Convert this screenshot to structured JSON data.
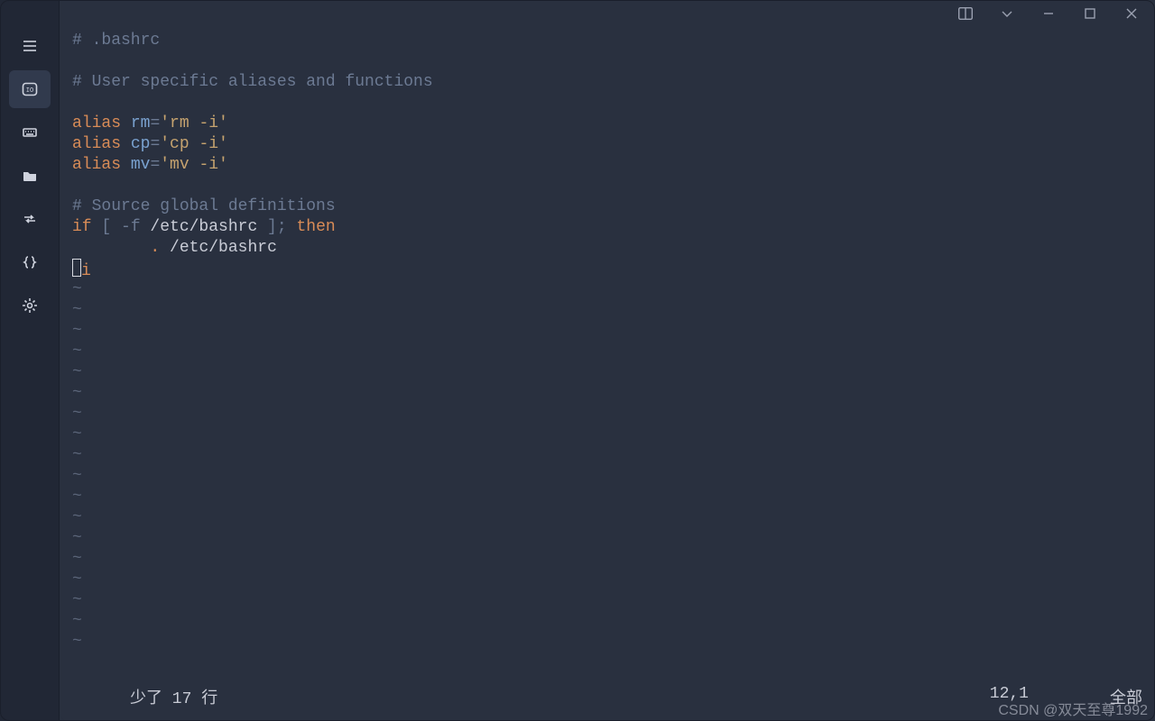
{
  "file": {
    "lines": [
      {
        "type": "comment",
        "raw": "# .bashrc"
      },
      {
        "type": "blank",
        "raw": ""
      },
      {
        "type": "comment",
        "raw": "# User specific aliases and functions"
      },
      {
        "type": "blank",
        "raw": ""
      },
      {
        "type": "alias",
        "kw": "alias",
        "name": "rm",
        "eq": "=",
        "val": "'rm -i'"
      },
      {
        "type": "alias",
        "kw": "alias",
        "name": "cp",
        "eq": "=",
        "val": "'cp -i'"
      },
      {
        "type": "alias",
        "kw": "alias",
        "name": "mv",
        "eq": "=",
        "val": "'mv -i'"
      },
      {
        "type": "blank",
        "raw": ""
      },
      {
        "type": "comment",
        "raw": "# Source global definitions"
      },
      {
        "type": "if",
        "kw": "if",
        "open": " [ ",
        "flag": "-f ",
        "path": "/etc/bashrc",
        "close": " ]; ",
        "then": "then"
      },
      {
        "type": "source",
        "indent": "        ",
        "dot": ".",
        "sep": " ",
        "path": "/etc/bashrc"
      },
      {
        "type": "fi",
        "cursor": true,
        "kw": "fi"
      }
    ],
    "tilde_rows": 18
  },
  "status": {
    "message": "少了 17 行",
    "position": "12,1",
    "whole": "全部"
  },
  "watermark": "CSDN @双天至尊1992",
  "sidebar": {
    "items": [
      {
        "name": "menu-icon"
      },
      {
        "name": "terminal-icon"
      },
      {
        "name": "keyboard-icon"
      },
      {
        "name": "folder-icon"
      },
      {
        "name": "transfer-icon"
      },
      {
        "name": "braces-icon"
      },
      {
        "name": "gear-icon"
      }
    ],
    "active_index": 1
  },
  "titlebar": {
    "buttons": [
      "split",
      "dropdown",
      "minimize",
      "maximize",
      "close"
    ]
  }
}
